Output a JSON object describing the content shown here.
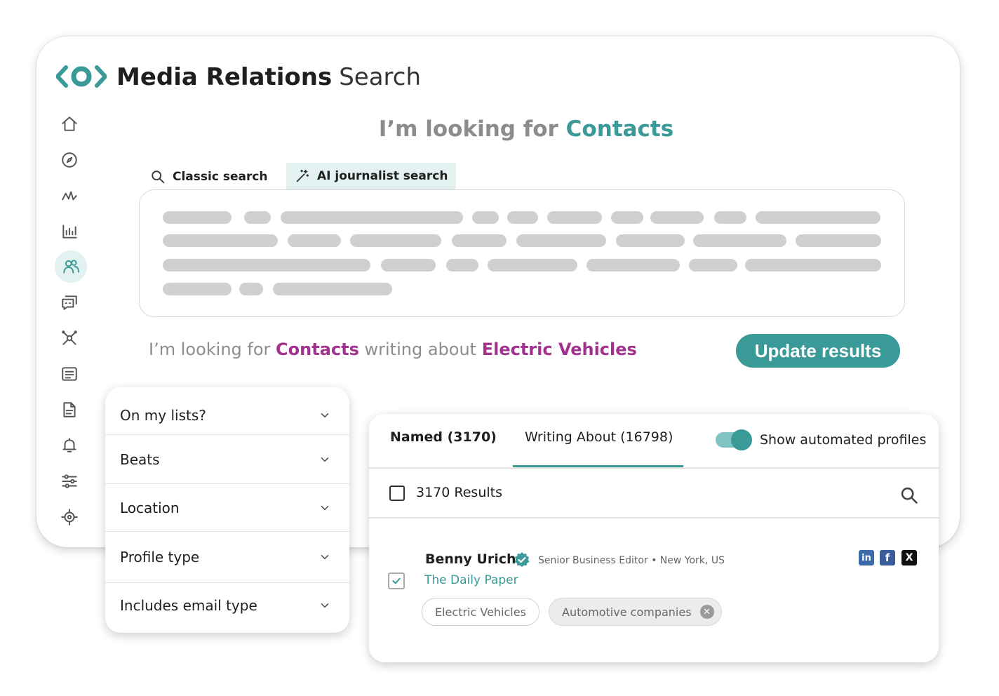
{
  "app": {
    "title_strong": "Media Relations",
    "title_light": "Search"
  },
  "headline": {
    "prefix": "I’m looking for",
    "entity": "Contacts"
  },
  "search_tabs": [
    {
      "label": "Classic search",
      "icon": "search-icon"
    },
    {
      "label": "AI journalist search",
      "icon": "magic-wand-icon",
      "active": true
    }
  ],
  "query_sentence": {
    "part1": "I’m looking for ",
    "entity": "Contacts",
    "part2": " writing about ",
    "topic": "Electric Vehicles"
  },
  "update_button": "Update results",
  "sidebar": {
    "items": [
      {
        "name": "home-icon"
      },
      {
        "name": "compass-icon"
      },
      {
        "name": "analytics-icon"
      },
      {
        "name": "bar-chart-icon"
      },
      {
        "name": "contacts-icon",
        "active": true
      },
      {
        "name": "chat-icon"
      },
      {
        "name": "network-icon"
      },
      {
        "name": "newsroom-icon"
      },
      {
        "name": "document-icon"
      },
      {
        "name": "bell-icon"
      },
      {
        "name": "sliders-icon"
      },
      {
        "name": "gear-icon"
      }
    ]
  },
  "filters": [
    {
      "label": "On my lists?"
    },
    {
      "label": "Beats"
    },
    {
      "label": "Location"
    },
    {
      "label": "Profile type"
    },
    {
      "label": "Includes email type"
    }
  ],
  "results": {
    "tab_named": "Named (3170)",
    "tab_writing": "Writing About (16798)",
    "toggle_label": "Show automated profiles",
    "toggle_on": true,
    "count_label": "3170 Results",
    "contact": {
      "name": "Benny Urich",
      "meta": "Senior Business Editor • New York, US",
      "outlet": "The Daily Paper",
      "checked": true,
      "social": [
        "linkedin-icon",
        "facebook-icon",
        "x-icon"
      ],
      "chips": [
        "Electric Vehicles",
        "Automotive companies"
      ]
    }
  },
  "colors": {
    "accent": "#3a9a98",
    "highlight": "#a3328f",
    "placeholder": "#d0d0d0"
  }
}
